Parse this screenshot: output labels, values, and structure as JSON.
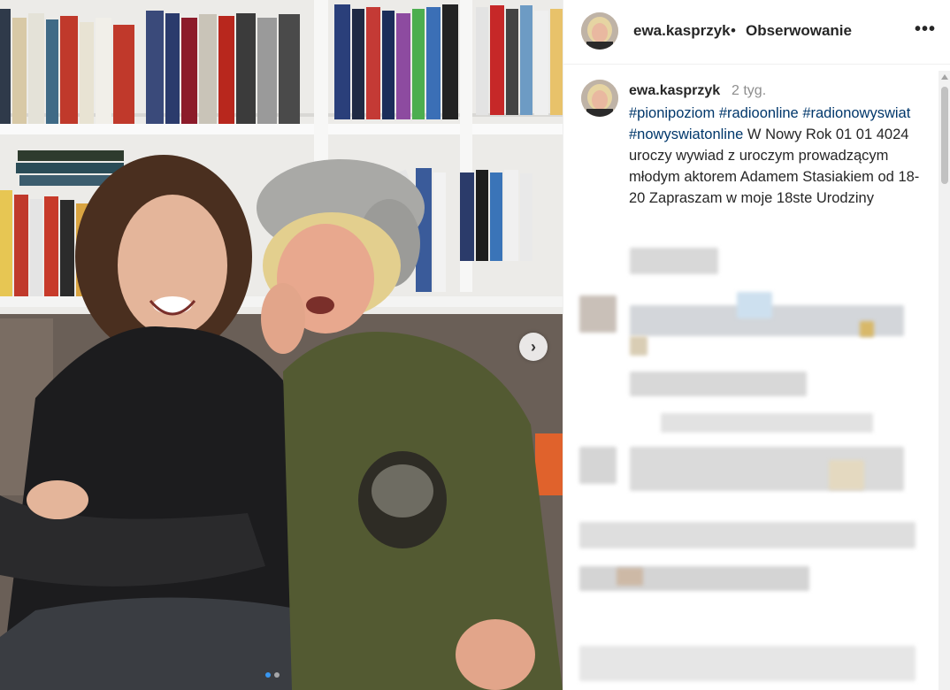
{
  "post": {
    "username": "ewa.kasprzyk",
    "separator": "•",
    "follow_label": "Obserwowanie",
    "more_icon": "more-horizontal-icon",
    "more_glyph": "•••"
  },
  "caption": {
    "username": "ewa.kasprzyk",
    "time": "2 tyg.",
    "hashtags": [
      "#pionipoziom",
      "#radioonline",
      "#radionowyswiat",
      "#nowyswiatonline"
    ],
    "text": "W Nowy Rok 01 01 4024 uroczy wywiad z uroczym prowadzącym młodym aktorem Adamem Stasiakiem od 18-20 Zapraszam w moje 18ste Urodziny"
  },
  "carousel": {
    "next_icon": "chevron-right-icon",
    "next_glyph": "›",
    "dots": 2,
    "active_dot": 0
  },
  "colors": {
    "text": "#262626",
    "hashtag": "#00376b",
    "muted": "#8e8e8e",
    "active_dot": "#3897f0"
  }
}
